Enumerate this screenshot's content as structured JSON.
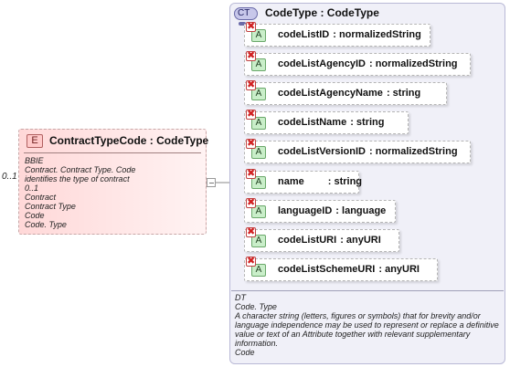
{
  "element": {
    "badge": "E",
    "title": "ContractTypeCode : CodeType",
    "cardinality": "0..1",
    "notes": [
      "BBIE",
      "Contract. Contract Type. Code",
      "identifies the type of contract",
      "0..1",
      "Contract",
      "Contract Type",
      "Code",
      "Code. Type"
    ]
  },
  "complex_type": {
    "badge": "CT",
    "title": "CodeType : CodeType",
    "attributes": [
      {
        "name": "codeListID",
        "type": ": normalizedString"
      },
      {
        "name": "codeListAgencyID",
        "type": ": normalizedString"
      },
      {
        "name": "codeListAgencyName",
        "type": ": string"
      },
      {
        "name": "codeListName",
        "type": ": string"
      },
      {
        "name": "codeListVersionID",
        "type": ": normalizedString"
      },
      {
        "name": "name",
        "type": ": string"
      },
      {
        "name": "languageID",
        "type": ": language"
      },
      {
        "name": "codeListURI",
        "type": ": anyURI"
      },
      {
        "name": "codeListSchemeURI",
        "type": ": anyURI"
      }
    ],
    "attr_badge": "A",
    "prohibited_mark": "✖",
    "notes": [
      "DT",
      "Code. Type",
      "A character string (letters, figures or symbols) that for brevity and/or",
      "language independence may be used to represent or replace a definitive",
      "value or text of an Attribute together with relevant supplementary",
      "information.",
      "Code"
    ]
  },
  "icons": {
    "element": "element-icon",
    "complex_type": "complex-type-icon",
    "attribute": "attribute-icon",
    "prohibited": "prohibited-icon",
    "connector": "sequence-connector-icon"
  }
}
